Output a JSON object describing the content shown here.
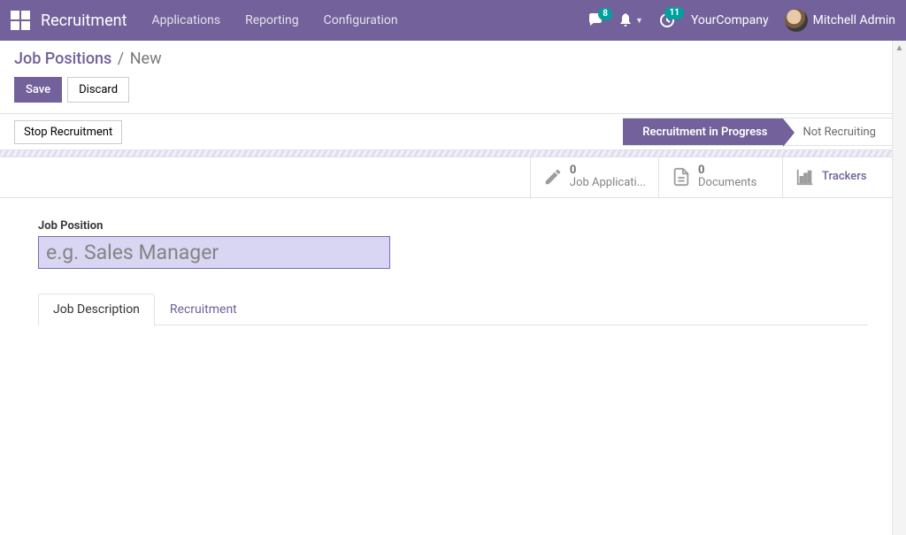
{
  "navbar": {
    "title": "Recruitment",
    "menu": [
      "Applications",
      "Reporting",
      "Configuration"
    ],
    "messages_badge": "8",
    "activities_badge": "11",
    "company": "YourCompany",
    "user": "Mitchell Admin"
  },
  "breadcrumb": {
    "parent": "Job Positions",
    "current": "New"
  },
  "cp_buttons": {
    "save": "Save",
    "discard": "Discard"
  },
  "statusbar": {
    "button": "Stop Recruitment",
    "stages": [
      {
        "label": "Recruitment in Progress",
        "active": true
      },
      {
        "label": "Not Recruiting",
        "active": false
      }
    ]
  },
  "stat_buttons": [
    {
      "count": "0",
      "label": "Job Applicati...",
      "icon": "pencil"
    },
    {
      "count": "0",
      "label": "Documents",
      "icon": "document"
    },
    {
      "count": "",
      "label": "Trackers",
      "icon": "chart"
    }
  ],
  "form": {
    "field_label": "Job Position",
    "placeholder": "e.g. Sales Manager",
    "value": ""
  },
  "tabs": [
    {
      "label": "Job Description",
      "active": true
    },
    {
      "label": "Recruitment",
      "active": false
    }
  ]
}
